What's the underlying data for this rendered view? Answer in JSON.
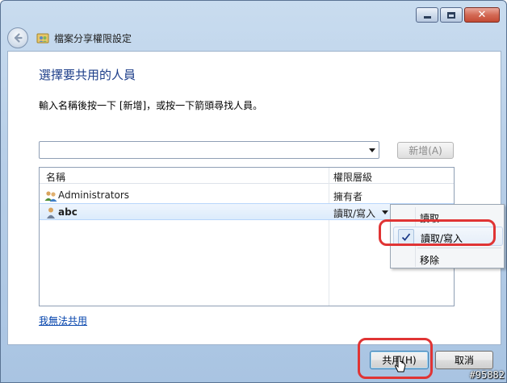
{
  "window": {
    "title": "檔案分享權限設定",
    "controls": {
      "minimize": "minimize",
      "maximize": "maximize",
      "close": "close"
    }
  },
  "dialog": {
    "heading": "選擇要共用的人員",
    "instruction": "輸入名稱後按一下 [新增]，或按一下箭頭尋找人員。",
    "name_input": {
      "value": "",
      "placeholder": ""
    },
    "add_button": "新增(A)"
  },
  "list": {
    "columns": {
      "name": "名稱",
      "permission": "權限層級"
    },
    "rows": [
      {
        "name": "Administrators",
        "permission": "擁有者",
        "icon": "users-group-icon"
      },
      {
        "name": "abc",
        "permission": "讀取/寫入",
        "icon": "user-icon",
        "selected": true
      }
    ]
  },
  "context_menu": {
    "items": [
      {
        "label": "讀取",
        "checked": false
      },
      {
        "label": "讀取/寫入",
        "checked": true
      },
      {
        "label": "移除",
        "checked": false
      }
    ]
  },
  "links": {
    "cant_share": "我無法共用"
  },
  "footer": {
    "share_button": "共用(H)",
    "cancel_button": "取消"
  },
  "watermark": "#95882",
  "colors": {
    "heading": "#1e3f8a",
    "link": "#0645ad",
    "highlight": "#e03434"
  }
}
